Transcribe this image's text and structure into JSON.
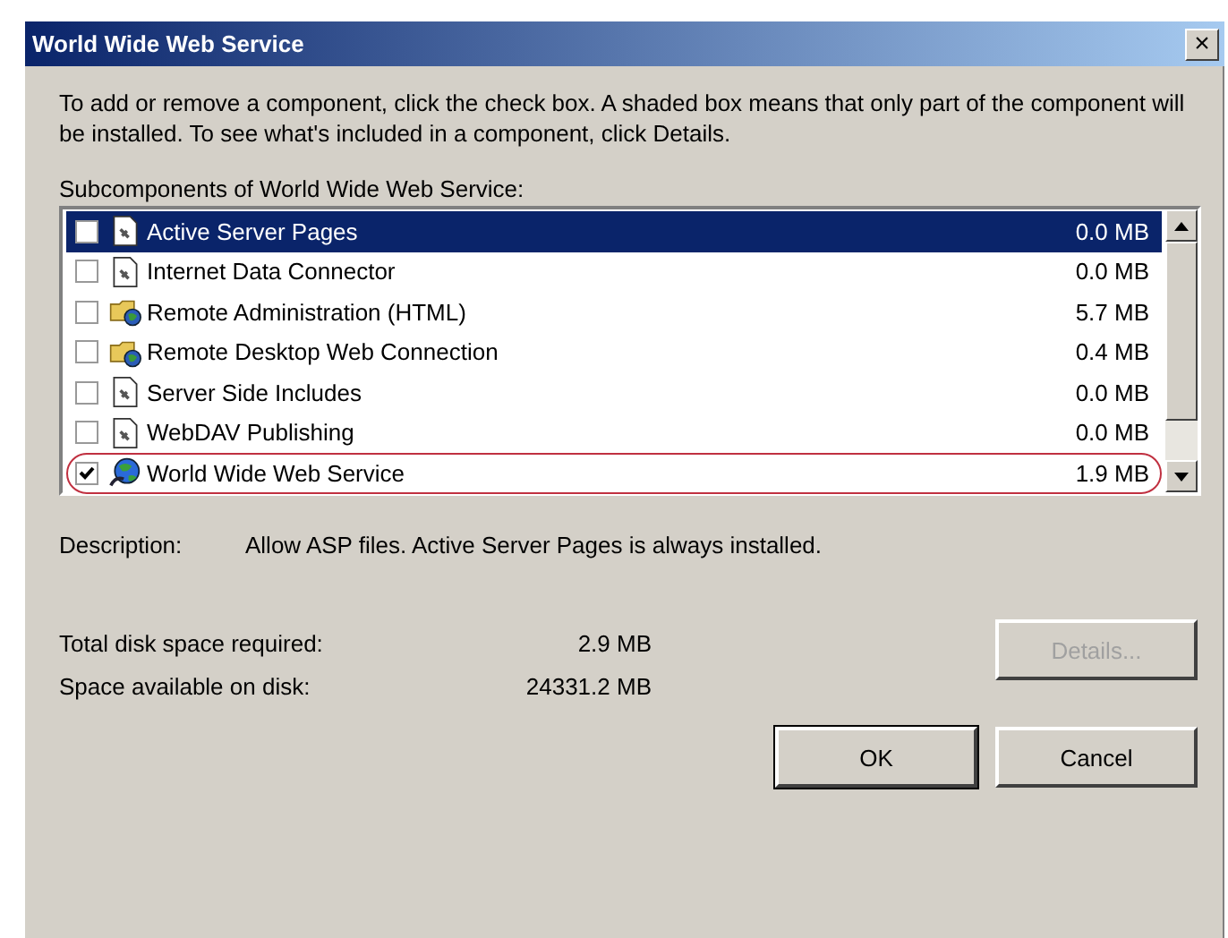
{
  "window": {
    "title": "World Wide Web Service",
    "close": "×"
  },
  "instructions": "To add or remove a component, click the check box. A shaded box means that only part of the component will be installed. To see what's included in a component, click Details.",
  "list_label": "Subcomponents of World Wide Web Service:",
  "components": [
    {
      "name": "Active Server Pages",
      "size": "0.0 MB",
      "checked": false,
      "selected": true,
      "circled": false,
      "kind": "document"
    },
    {
      "name": "Internet Data Connector",
      "size": "0.0 MB",
      "checked": false,
      "selected": false,
      "circled": false,
      "kind": "document"
    },
    {
      "name": "Remote Administration (HTML)",
      "size": "5.7 MB",
      "checked": false,
      "selected": false,
      "circled": false,
      "kind": "folder"
    },
    {
      "name": "Remote Desktop Web Connection",
      "size": "0.4 MB",
      "checked": false,
      "selected": false,
      "circled": false,
      "kind": "folder"
    },
    {
      "name": "Server Side Includes",
      "size": "0.0 MB",
      "checked": false,
      "selected": false,
      "circled": false,
      "kind": "document"
    },
    {
      "name": "WebDAV Publishing",
      "size": "0.0 MB",
      "checked": false,
      "selected": false,
      "circled": false,
      "kind": "document"
    },
    {
      "name": "World Wide Web Service",
      "size": "1.9 MB",
      "checked": true,
      "selected": false,
      "circled": true,
      "kind": "globe"
    }
  ],
  "description": {
    "label": "Description:",
    "text": "Allow ASP files.  Active Server Pages is always installed."
  },
  "disk": [
    {
      "label": "Total disk space required:",
      "value": "2.9 MB"
    },
    {
      "label": "Space available on disk:",
      "value": "24331.2 MB"
    }
  ],
  "buttons": [
    {
      "label": "Details...",
      "disabled": true,
      "kind": "details"
    },
    {
      "label": "OK",
      "disabled": false,
      "kind": "ok"
    },
    {
      "label": "Cancel",
      "disabled": false,
      "kind": "cancel"
    }
  ]
}
